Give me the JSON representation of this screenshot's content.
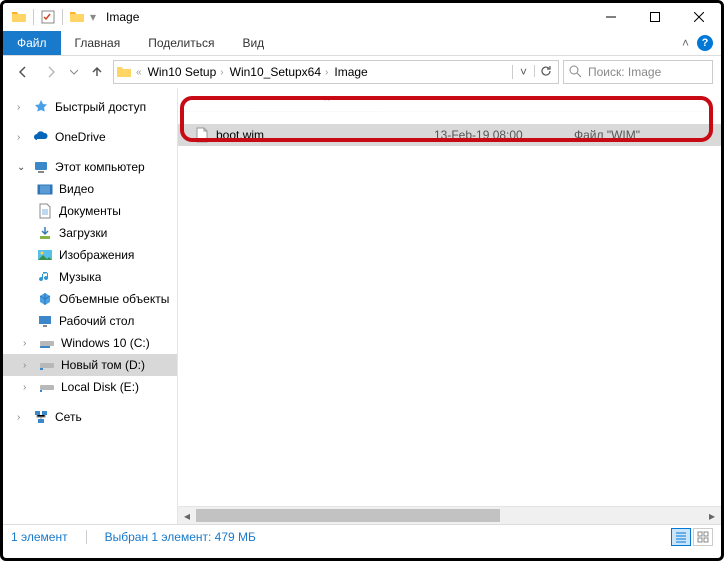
{
  "window": {
    "title": "Image"
  },
  "ribbon": {
    "file": "Файл",
    "tabs": [
      "Главная",
      "Поделиться",
      "Вид"
    ]
  },
  "breadcrumbs": [
    "Win10 Setup",
    "Win10_Setupx64",
    "Image"
  ],
  "search": {
    "placeholder": "Поиск: Image"
  },
  "sidebar": {
    "quick_access": "Быстрый доступ",
    "onedrive": "OneDrive",
    "this_pc": "Этот компьютер",
    "items": [
      {
        "label": "Видео"
      },
      {
        "label": "Документы"
      },
      {
        "label": "Загрузки"
      },
      {
        "label": "Изображения"
      },
      {
        "label": "Музыка"
      },
      {
        "label": "Объемные объекты"
      },
      {
        "label": "Рабочий стол"
      },
      {
        "label": "Windows 10 (C:)"
      },
      {
        "label": "Новый том (D:)"
      },
      {
        "label": "Local Disk (E:)"
      }
    ],
    "network": "Сеть"
  },
  "file": {
    "name": "boot.wim",
    "date": "13-Feb-19 08:00",
    "type": "Файл \"WIM\""
  },
  "statusbar": {
    "count": "1 элемент",
    "selection": "Выбран 1 элемент: 479 МБ"
  }
}
